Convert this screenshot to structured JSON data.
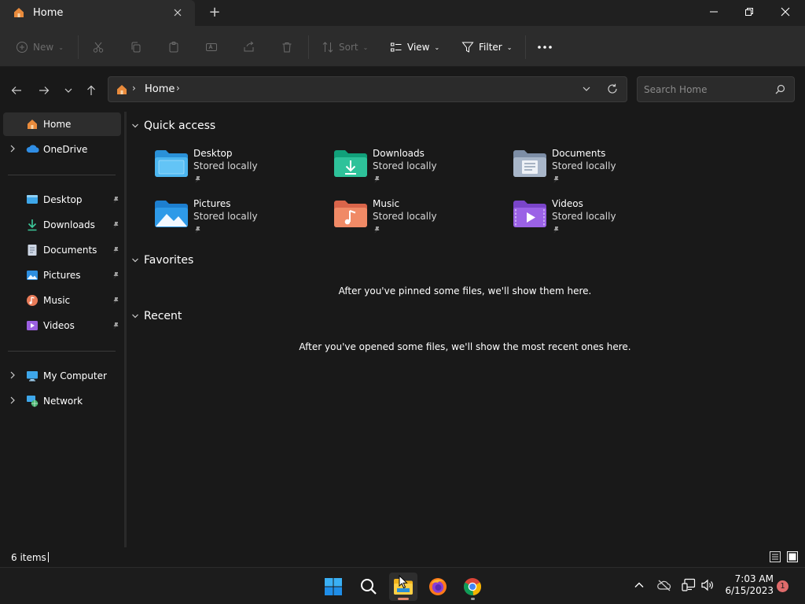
{
  "window": {
    "tab_title": "Home",
    "new_tab_symbol": "+"
  },
  "toolbar": {
    "new_label": "New",
    "sort_label": "Sort",
    "view_label": "View",
    "filter_label": "Filter"
  },
  "address": {
    "crumb": "Home",
    "search_placeholder": "Search Home"
  },
  "sidebar": {
    "items": [
      {
        "label": "Home"
      },
      {
        "label": "OneDrive"
      },
      {
        "label": "Desktop"
      },
      {
        "label": "Downloads"
      },
      {
        "label": "Documents"
      },
      {
        "label": "Pictures"
      },
      {
        "label": "Music"
      },
      {
        "label": "Videos"
      },
      {
        "label": "My Computer"
      },
      {
        "label": "Network"
      }
    ]
  },
  "content": {
    "quick_access_title": "Quick access",
    "favorites_title": "Favorites",
    "recent_title": "Recent",
    "favorites_empty": "After you've pinned some files, we'll show them here.",
    "recent_empty": "After you've opened some files, we'll show the most recent ones here.",
    "quick_access": [
      {
        "name": "Desktop",
        "status": "Stored locally",
        "icon": "desktop-folder-icon"
      },
      {
        "name": "Downloads",
        "status": "Stored locally",
        "icon": "downloads-folder-icon"
      },
      {
        "name": "Documents",
        "status": "Stored locally",
        "icon": "documents-folder-icon"
      },
      {
        "name": "Pictures",
        "status": "Stored locally",
        "icon": "pictures-folder-icon"
      },
      {
        "name": "Music",
        "status": "Stored locally",
        "icon": "music-folder-icon"
      },
      {
        "name": "Videos",
        "status": "Stored locally",
        "icon": "videos-folder-icon"
      }
    ]
  },
  "status": {
    "item_count": "6 items"
  },
  "taskbar": {
    "time": "7:03 AM",
    "date": "6/15/2023",
    "notification_count": "1"
  },
  "colors": {
    "accent_folder_blue": "#3ea7ea",
    "home_icon_orange": "#e98b3c",
    "notification_red": "#e06b6b"
  }
}
